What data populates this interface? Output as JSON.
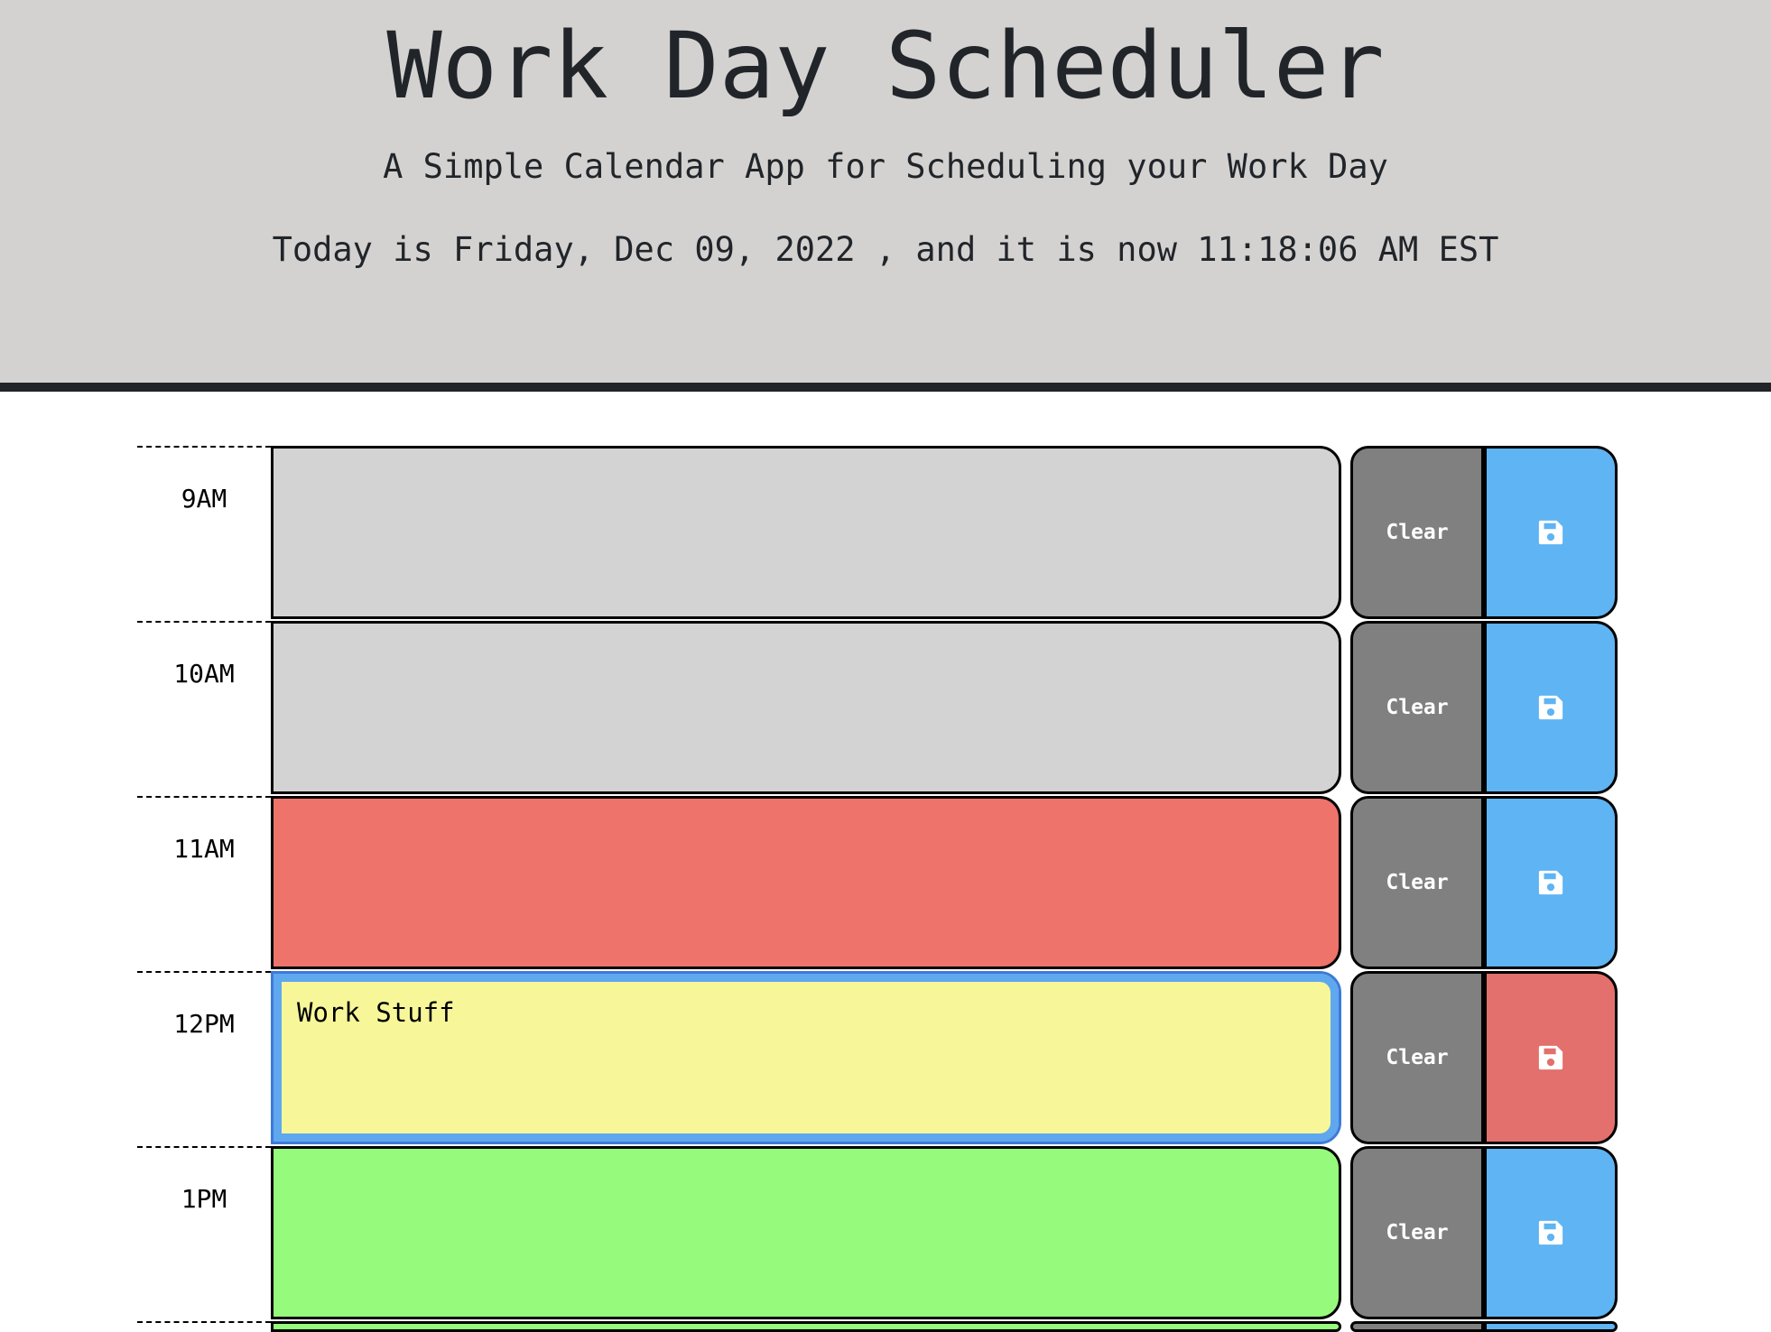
{
  "header": {
    "title": "Work Day Scheduler",
    "subtitle": "A Simple Calendar App for Scheduling your Work Day",
    "datetime": "Today is Friday, Dec 09, 2022 , and it is now 11:18:06 AM EST"
  },
  "colors": {
    "past": "#d3d3d3",
    "present": "#ee736b",
    "future": "#96fb7d",
    "focused": "#f7f79a",
    "save": "#5fb4f3",
    "save_active": "#e3706c",
    "clear": "#808080",
    "header_bg": "#d3d2d1"
  },
  "rows": [
    {
      "hour": "9AM",
      "text": "",
      "state": "past",
      "clear_label": "Clear",
      "save_icon": "floppy-disk-icon"
    },
    {
      "hour": "10AM",
      "text": "",
      "state": "past",
      "clear_label": "Clear",
      "save_icon": "floppy-disk-icon"
    },
    {
      "hour": "11AM",
      "text": "",
      "state": "present",
      "clear_label": "Clear",
      "save_icon": "floppy-disk-icon"
    },
    {
      "hour": "12PM",
      "text": "Work Stuff",
      "state": "focused",
      "clear_label": "Clear",
      "save_icon": "floppy-disk-icon"
    },
    {
      "hour": "1PM",
      "text": "",
      "state": "future",
      "clear_label": "Clear",
      "save_icon": "floppy-disk-icon"
    }
  ]
}
